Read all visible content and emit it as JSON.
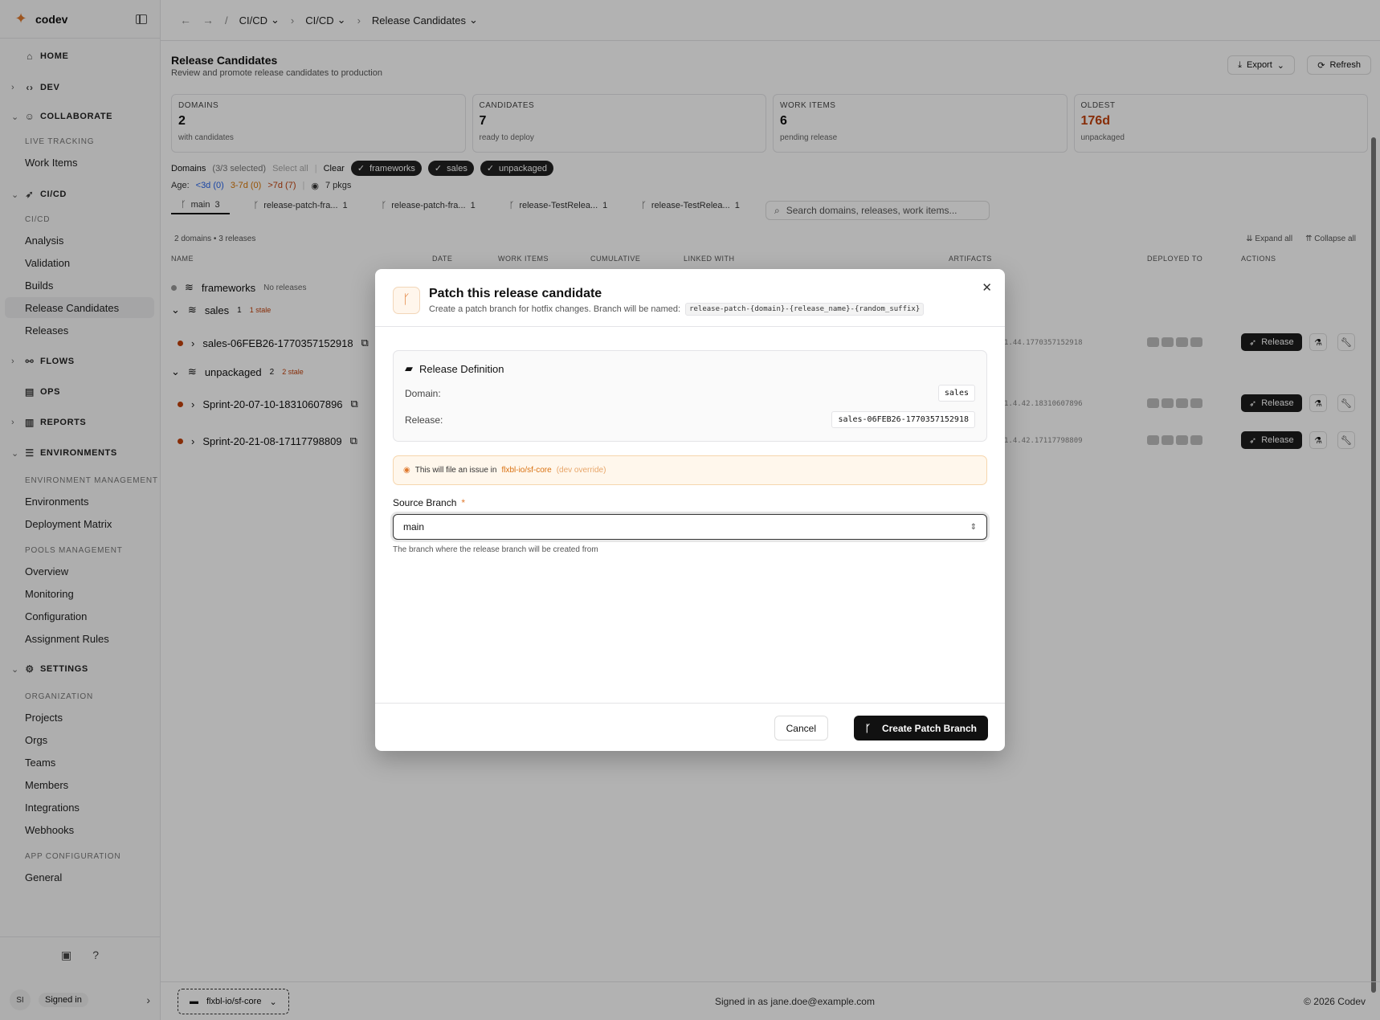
{
  "app": {
    "brand": "codev"
  },
  "sidebar": {
    "sections": [
      {
        "label": "HOME",
        "icon": "home-icon"
      },
      {
        "label": "DEV",
        "icon": "code-icon"
      },
      {
        "label": "COLLABORATE",
        "icon": "users-icon"
      },
      {
        "label": "CI/CD",
        "icon": "rocket-icon"
      },
      {
        "label": "FLOWS",
        "icon": "flow-icon"
      },
      {
        "label": "OPS",
        "icon": "ops-icon"
      },
      {
        "label": "REPORTS",
        "icon": "chart-icon"
      },
      {
        "label": "ENVIRONMENTS",
        "icon": "server-icon"
      },
      {
        "label": "SETTINGS",
        "icon": "gear-icon"
      }
    ],
    "groups": [
      "LIVE TRACKING",
      "CI/CD",
      "ENVIRONMENT MANAGEMENT",
      "POOLS MANAGEMENT",
      "ORGANIZATION",
      "APP CONFIGURATION"
    ],
    "items": [
      "Work Items",
      "Analysis",
      "Validation",
      "Builds",
      "Release Candidates",
      "Releases",
      "Environments",
      "Deployment Matrix",
      "Overview",
      "Monitoring",
      "Configuration",
      "Assignment Rules",
      "Projects",
      "Orgs",
      "Teams",
      "Members",
      "Integrations",
      "Webhooks",
      "General"
    ],
    "user_initials": "SI",
    "user_status": "Signed in"
  },
  "breadcrumb": {
    "sep": "/",
    "items": [
      "CI/CD",
      "CI/CD",
      "Release Candidates"
    ]
  },
  "page": {
    "title": "Release Candidates",
    "subtitle": "Review and promote release candidates to production",
    "export": "Export",
    "refresh": "Refresh"
  },
  "stats": [
    {
      "label": "DOMAINS",
      "value": "2",
      "sub": "with candidates",
      "color": "#111111"
    },
    {
      "label": "CANDIDATES",
      "value": "7",
      "sub": "ready to deploy",
      "color": "#111111"
    },
    {
      "label": "WORK ITEMS",
      "value": "6",
      "sub": "pending release",
      "color": "#111111"
    },
    {
      "label": "OLDEST",
      "value": "176d",
      "sub": "unpackaged",
      "color": "#c2410c"
    }
  ],
  "filters": {
    "label": "Domains",
    "count": "(3/3 selected)",
    "select_all": "Select all",
    "clear": "Clear",
    "chips": [
      "frameworks",
      "sales",
      "unpackaged"
    ]
  },
  "age": {
    "label": "Age:",
    "a": "<3d (0)",
    "b": "3-7d (0)",
    "c": ">7d (7)",
    "pkgs": "7 pkgs"
  },
  "tabs": [
    {
      "label": "main",
      "count": "3"
    },
    {
      "label": "release-patch-fra...",
      "count": "1"
    },
    {
      "label": "release-patch-fra...",
      "count": "1"
    },
    {
      "label": "release-TestRelea...",
      "count": "1"
    },
    {
      "label": "release-TestRelea...",
      "count": "1"
    }
  ],
  "search": {
    "placeholder": "Search domains, releases, work items..."
  },
  "list": {
    "meta": "2 domains • 3 releases",
    "expand_all": "Expand all",
    "collapse_all": "Collapse all"
  },
  "table": {
    "headers": {
      "name": "NAME",
      "date": "DATE",
      "work_items": "WORK ITEMS",
      "cumulative": "CUMULATIVE",
      "linked": "LINKED WITH",
      "artifacts": "ARTIFACTS",
      "deployed": "DEPLOYED TO",
      "actions": "ACTIONS"
    },
    "domains": [
      {
        "name": "frameworks",
        "note": "No releases"
      },
      {
        "name": "sales",
        "count": "1",
        "stale": "1 stale"
      },
      {
        "name": "unpackaged",
        "count": "2",
        "stale": "2 stale"
      }
    ],
    "releases": [
      {
        "name": "sales-06FEB26-1770357152918",
        "artifact": "1.44.1770357152918"
      },
      {
        "name": "Sprint-20-07-10-18310607896",
        "artifact": "1.4.42.18310607896"
      },
      {
        "name": "Sprint-20-21-08-17117798809",
        "artifact": "1.4.42.17117798809"
      }
    ],
    "release_btn": "Release"
  },
  "footer": {
    "repo": "flxbl-io/sf-core",
    "signed": "Signed in as jane.doe@example.com",
    "copy": "© 2026 Codev"
  },
  "modal": {
    "title": "Patch this release candidate",
    "desc": "Create a patch branch for hotfix changes. Branch will be named:",
    "pattern": "release-patch-{domain}-{release_name}-{random_suffix}",
    "def_title": "Release Definition",
    "domain_label": "Domain:",
    "domain_value": "sales",
    "release_label": "Release:",
    "release_value": "sales-06FEB26-1770357152918",
    "warn_text": "This will file an issue in",
    "warn_repo": "flxbl-io/sf-core",
    "warn_override": "(dev override)",
    "field_label": "Source Branch",
    "required": "*",
    "field_value": "main",
    "help": "The branch where the release branch will be created from",
    "cancel": "Cancel",
    "create": "Create Patch Branch"
  },
  "colors": {
    "accent": "#e07a2f",
    "dark": "#111111",
    "stale": "#c2410c"
  }
}
